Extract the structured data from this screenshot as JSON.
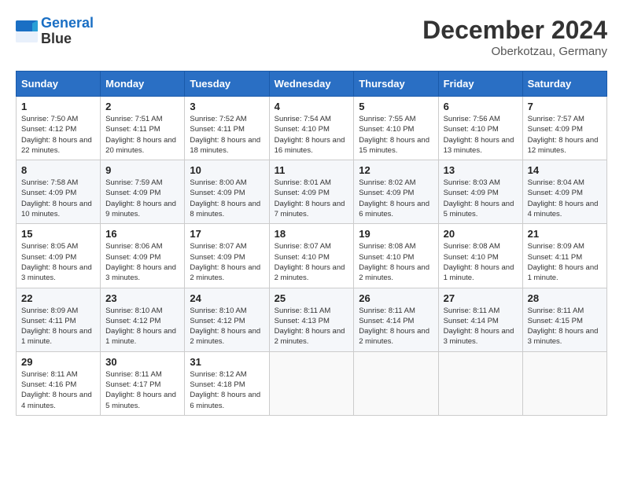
{
  "header": {
    "logo_line1": "General",
    "logo_line2": "Blue",
    "month": "December 2024",
    "location": "Oberkotzau, Germany"
  },
  "weekdays": [
    "Sunday",
    "Monday",
    "Tuesday",
    "Wednesday",
    "Thursday",
    "Friday",
    "Saturday"
  ],
  "weeks": [
    [
      {
        "day": "1",
        "sunrise": "Sunrise: 7:50 AM",
        "sunset": "Sunset: 4:12 PM",
        "daylight": "Daylight: 8 hours and 22 minutes."
      },
      {
        "day": "2",
        "sunrise": "Sunrise: 7:51 AM",
        "sunset": "Sunset: 4:11 PM",
        "daylight": "Daylight: 8 hours and 20 minutes."
      },
      {
        "day": "3",
        "sunrise": "Sunrise: 7:52 AM",
        "sunset": "Sunset: 4:11 PM",
        "daylight": "Daylight: 8 hours and 18 minutes."
      },
      {
        "day": "4",
        "sunrise": "Sunrise: 7:54 AM",
        "sunset": "Sunset: 4:10 PM",
        "daylight": "Daylight: 8 hours and 16 minutes."
      },
      {
        "day": "5",
        "sunrise": "Sunrise: 7:55 AM",
        "sunset": "Sunset: 4:10 PM",
        "daylight": "Daylight: 8 hours and 15 minutes."
      },
      {
        "day": "6",
        "sunrise": "Sunrise: 7:56 AM",
        "sunset": "Sunset: 4:10 PM",
        "daylight": "Daylight: 8 hours and 13 minutes."
      },
      {
        "day": "7",
        "sunrise": "Sunrise: 7:57 AM",
        "sunset": "Sunset: 4:09 PM",
        "daylight": "Daylight: 8 hours and 12 minutes."
      }
    ],
    [
      {
        "day": "8",
        "sunrise": "Sunrise: 7:58 AM",
        "sunset": "Sunset: 4:09 PM",
        "daylight": "Daylight: 8 hours and 10 minutes."
      },
      {
        "day": "9",
        "sunrise": "Sunrise: 7:59 AM",
        "sunset": "Sunset: 4:09 PM",
        "daylight": "Daylight: 8 hours and 9 minutes."
      },
      {
        "day": "10",
        "sunrise": "Sunrise: 8:00 AM",
        "sunset": "Sunset: 4:09 PM",
        "daylight": "Daylight: 8 hours and 8 minutes."
      },
      {
        "day": "11",
        "sunrise": "Sunrise: 8:01 AM",
        "sunset": "Sunset: 4:09 PM",
        "daylight": "Daylight: 8 hours and 7 minutes."
      },
      {
        "day": "12",
        "sunrise": "Sunrise: 8:02 AM",
        "sunset": "Sunset: 4:09 PM",
        "daylight": "Daylight: 8 hours and 6 minutes."
      },
      {
        "day": "13",
        "sunrise": "Sunrise: 8:03 AM",
        "sunset": "Sunset: 4:09 PM",
        "daylight": "Daylight: 8 hours and 5 minutes."
      },
      {
        "day": "14",
        "sunrise": "Sunrise: 8:04 AM",
        "sunset": "Sunset: 4:09 PM",
        "daylight": "Daylight: 8 hours and 4 minutes."
      }
    ],
    [
      {
        "day": "15",
        "sunrise": "Sunrise: 8:05 AM",
        "sunset": "Sunset: 4:09 PM",
        "daylight": "Daylight: 8 hours and 3 minutes."
      },
      {
        "day": "16",
        "sunrise": "Sunrise: 8:06 AM",
        "sunset": "Sunset: 4:09 PM",
        "daylight": "Daylight: 8 hours and 3 minutes."
      },
      {
        "day": "17",
        "sunrise": "Sunrise: 8:07 AM",
        "sunset": "Sunset: 4:09 PM",
        "daylight": "Daylight: 8 hours and 2 minutes."
      },
      {
        "day": "18",
        "sunrise": "Sunrise: 8:07 AM",
        "sunset": "Sunset: 4:10 PM",
        "daylight": "Daylight: 8 hours and 2 minutes."
      },
      {
        "day": "19",
        "sunrise": "Sunrise: 8:08 AM",
        "sunset": "Sunset: 4:10 PM",
        "daylight": "Daylight: 8 hours and 2 minutes."
      },
      {
        "day": "20",
        "sunrise": "Sunrise: 8:08 AM",
        "sunset": "Sunset: 4:10 PM",
        "daylight": "Daylight: 8 hours and 1 minute."
      },
      {
        "day": "21",
        "sunrise": "Sunrise: 8:09 AM",
        "sunset": "Sunset: 4:11 PM",
        "daylight": "Daylight: 8 hours and 1 minute."
      }
    ],
    [
      {
        "day": "22",
        "sunrise": "Sunrise: 8:09 AM",
        "sunset": "Sunset: 4:11 PM",
        "daylight": "Daylight: 8 hours and 1 minute."
      },
      {
        "day": "23",
        "sunrise": "Sunrise: 8:10 AM",
        "sunset": "Sunset: 4:12 PM",
        "daylight": "Daylight: 8 hours and 1 minute."
      },
      {
        "day": "24",
        "sunrise": "Sunrise: 8:10 AM",
        "sunset": "Sunset: 4:12 PM",
        "daylight": "Daylight: 8 hours and 2 minutes."
      },
      {
        "day": "25",
        "sunrise": "Sunrise: 8:11 AM",
        "sunset": "Sunset: 4:13 PM",
        "daylight": "Daylight: 8 hours and 2 minutes."
      },
      {
        "day": "26",
        "sunrise": "Sunrise: 8:11 AM",
        "sunset": "Sunset: 4:14 PM",
        "daylight": "Daylight: 8 hours and 2 minutes."
      },
      {
        "day": "27",
        "sunrise": "Sunrise: 8:11 AM",
        "sunset": "Sunset: 4:14 PM",
        "daylight": "Daylight: 8 hours and 3 minutes."
      },
      {
        "day": "28",
        "sunrise": "Sunrise: 8:11 AM",
        "sunset": "Sunset: 4:15 PM",
        "daylight": "Daylight: 8 hours and 3 minutes."
      }
    ],
    [
      {
        "day": "29",
        "sunrise": "Sunrise: 8:11 AM",
        "sunset": "Sunset: 4:16 PM",
        "daylight": "Daylight: 8 hours and 4 minutes."
      },
      {
        "day": "30",
        "sunrise": "Sunrise: 8:11 AM",
        "sunset": "Sunset: 4:17 PM",
        "daylight": "Daylight: 8 hours and 5 minutes."
      },
      {
        "day": "31",
        "sunrise": "Sunrise: 8:12 AM",
        "sunset": "Sunset: 4:18 PM",
        "daylight": "Daylight: 8 hours and 6 minutes."
      },
      null,
      null,
      null,
      null
    ]
  ]
}
